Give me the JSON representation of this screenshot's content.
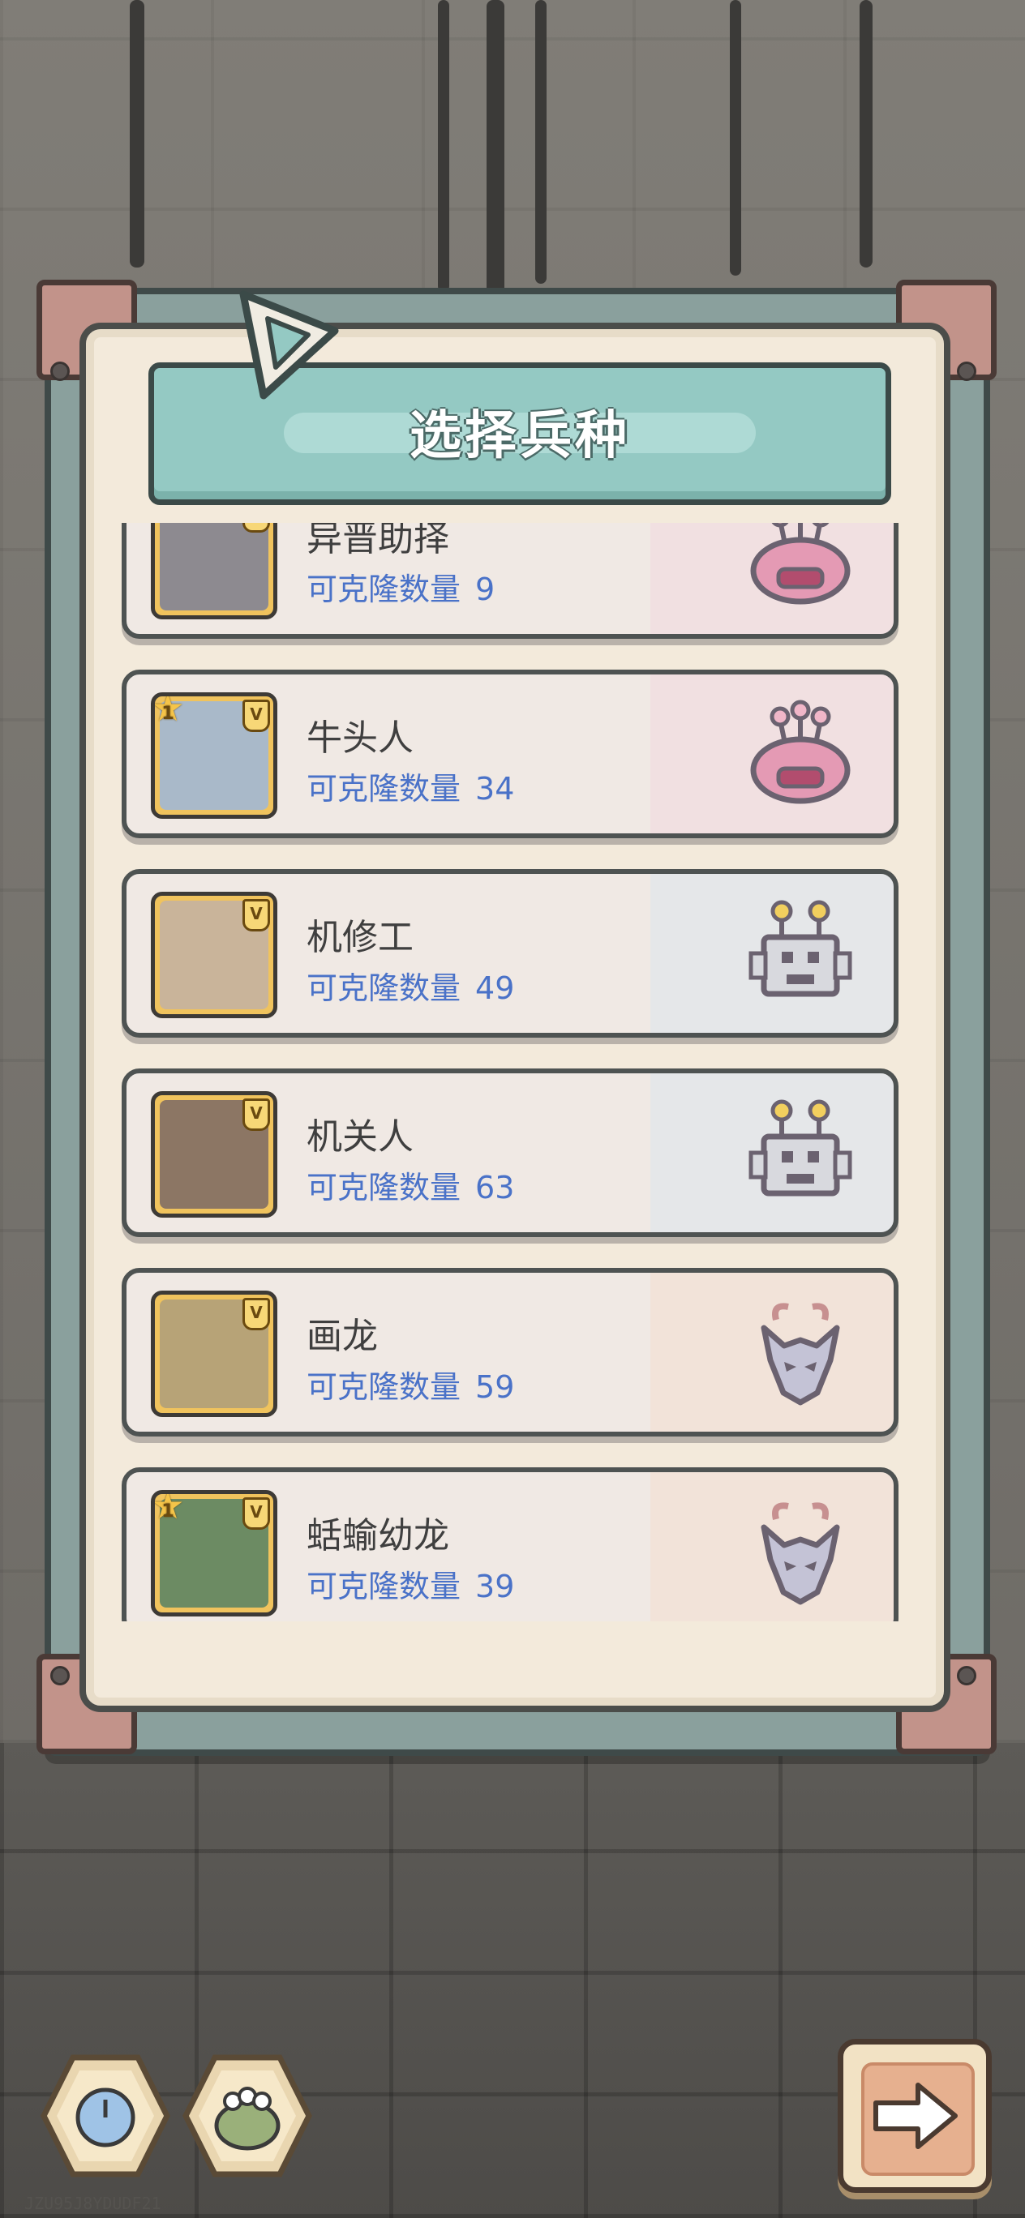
{
  "screen": {
    "title": "选择兵种"
  },
  "units": [
    {
      "name": "异晋助择",
      "clone_label": "可克隆数量",
      "clone_count": "9",
      "star": "",
      "type_icon": "tentacle-monster-icon",
      "tint": "#f1d4de",
      "portrait_bg": "#8d8a90"
    },
    {
      "name": "牛头人",
      "clone_label": "可克隆数量",
      "clone_count": "34",
      "star": "1",
      "type_icon": "tentacle-monster-icon",
      "tint": "#f1d4de",
      "portrait_bg": "#a9b9c9"
    },
    {
      "name": "机修工",
      "clone_label": "可克隆数量",
      "clone_count": "49",
      "star": "",
      "type_icon": "robot-icon",
      "tint": "#d6e4ef",
      "portrait_bg": "#c9b49a"
    },
    {
      "name": "机关人",
      "clone_label": "可克隆数量",
      "clone_count": "63",
      "star": "",
      "type_icon": "robot-icon",
      "tint": "#d6e4ef",
      "portrait_bg": "#8c7664"
    },
    {
      "name": "画龙",
      "clone_label": "可克隆数量",
      "clone_count": "59",
      "star": "",
      "type_icon": "dragon-icon",
      "tint": "#f3dccd",
      "portrait_bg": "#b7a377"
    },
    {
      "name": "蛞蝓幼龙",
      "clone_label": "可克隆数量",
      "clone_count": "39",
      "star": "1",
      "type_icon": "dragon-icon",
      "tint": "#f3dccd",
      "portrait_bg": "#6c8b63"
    }
  ],
  "bottom": {
    "left_buttons": [
      "clock-creature-icon",
      "frog-creature-icon"
    ],
    "next_icon": "arrow-right-icon",
    "watermark": "JZU95J8YDUDF21"
  },
  "colors": {
    "clone_text": "#4a72c8",
    "banner": "#94c9c3",
    "panel": "#f3eadb"
  }
}
